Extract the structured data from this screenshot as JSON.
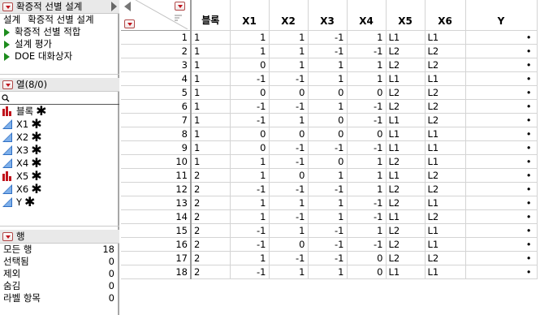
{
  "table_panel": {
    "title": "확증적 선별 설계",
    "refs": [
      "설계",
      "확증적 선별 설계"
    ],
    "scripts": [
      "확증적 선별 적합",
      "설계 평가",
      "DOE 대화상자"
    ]
  },
  "columns_panel": {
    "title": "열(8/0)",
    "search_placeholder": "",
    "columns": [
      {
        "name": "블록",
        "type": "nominal"
      },
      {
        "name": "X1",
        "type": "continuous"
      },
      {
        "name": "X2",
        "type": "continuous"
      },
      {
        "name": "X3",
        "type": "continuous"
      },
      {
        "name": "X4",
        "type": "continuous"
      },
      {
        "name": "X5",
        "type": "nominal"
      },
      {
        "name": "X6",
        "type": "continuous"
      },
      {
        "name": "Y",
        "type": "continuous"
      }
    ],
    "star": "✱"
  },
  "rows_panel": {
    "title": "행",
    "items": [
      {
        "label": "모든 행",
        "value": "18"
      },
      {
        "label": "선택됨",
        "value": "0"
      },
      {
        "label": "제외",
        "value": "0"
      },
      {
        "label": "숨김",
        "value": "0"
      },
      {
        "label": "라벨 항목",
        "value": "0"
      }
    ]
  },
  "grid": {
    "headers": [
      "블록",
      "X1",
      "X2",
      "X3",
      "X4",
      "X5",
      "X6",
      "Y"
    ],
    "rows": [
      [
        "1",
        "1",
        "1",
        "1",
        "-1",
        "1",
        "L1",
        "L1",
        "•"
      ],
      [
        "2",
        "1",
        "1",
        "1",
        "-1",
        "-1",
        "L2",
        "L2",
        "•"
      ],
      [
        "3",
        "1",
        "0",
        "1",
        "1",
        "1",
        "L2",
        "L2",
        "•"
      ],
      [
        "4",
        "1",
        "-1",
        "-1",
        "1",
        "1",
        "L1",
        "L1",
        "•"
      ],
      [
        "5",
        "1",
        "0",
        "0",
        "0",
        "0",
        "L2",
        "L2",
        "•"
      ],
      [
        "6",
        "1",
        "-1",
        "-1",
        "1",
        "-1",
        "L2",
        "L2",
        "•"
      ],
      [
        "7",
        "1",
        "-1",
        "1",
        "0",
        "-1",
        "L1",
        "L2",
        "•"
      ],
      [
        "8",
        "1",
        "0",
        "0",
        "0",
        "0",
        "L1",
        "L1",
        "•"
      ],
      [
        "9",
        "1",
        "0",
        "-1",
        "-1",
        "-1",
        "L1",
        "L1",
        "•"
      ],
      [
        "10",
        "1",
        "1",
        "-1",
        "0",
        "1",
        "L2",
        "L1",
        "•"
      ],
      [
        "11",
        "2",
        "1",
        "0",
        "1",
        "1",
        "L1",
        "L2",
        "•"
      ],
      [
        "12",
        "2",
        "-1",
        "-1",
        "-1",
        "1",
        "L2",
        "L2",
        "•"
      ],
      [
        "13",
        "2",
        "1",
        "1",
        "1",
        "-1",
        "L2",
        "L1",
        "•"
      ],
      [
        "14",
        "2",
        "1",
        "-1",
        "1",
        "-1",
        "L1",
        "L2",
        "•"
      ],
      [
        "15",
        "2",
        "-1",
        "1",
        "-1",
        "1",
        "L2",
        "L1",
        "•"
      ],
      [
        "16",
        "2",
        "-1",
        "0",
        "-1",
        "-1",
        "L2",
        "L1",
        "•"
      ],
      [
        "17",
        "2",
        "1",
        "-1",
        "-1",
        "0",
        "L2",
        "L2",
        "•"
      ],
      [
        "18",
        "2",
        "-1",
        "1",
        "1",
        "0",
        "L1",
        "L1",
        "•"
      ]
    ]
  }
}
